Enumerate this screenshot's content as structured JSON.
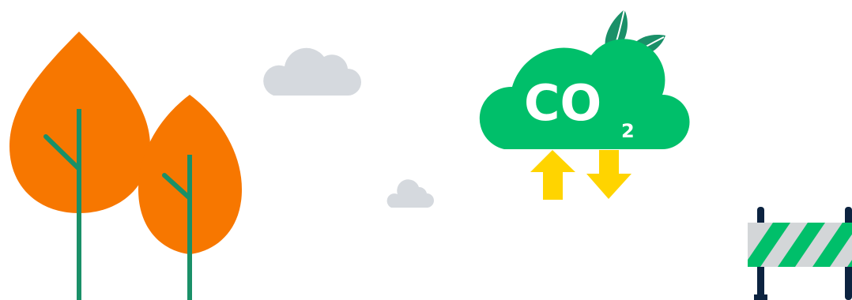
{
  "illustration": {
    "co2_badge": {
      "main": "CO",
      "subscript": "2"
    },
    "colors": {
      "tree_orange": "#F77700",
      "trunk_green": "#1A9068",
      "cloud_green": "#00BF6A",
      "leaf_dark_green": "#1A9068",
      "arrow_yellow": "#FFD400",
      "cloud_gray": "#D5D9DE",
      "barrier_navy": "#0C2340",
      "barrier_stripe_gray": "#D3D6D8"
    },
    "icons": [
      "tree-icon",
      "cloud-icon",
      "co2-cloud-icon",
      "arrow-up-icon",
      "arrow-down-icon",
      "barrier-icon"
    ]
  }
}
